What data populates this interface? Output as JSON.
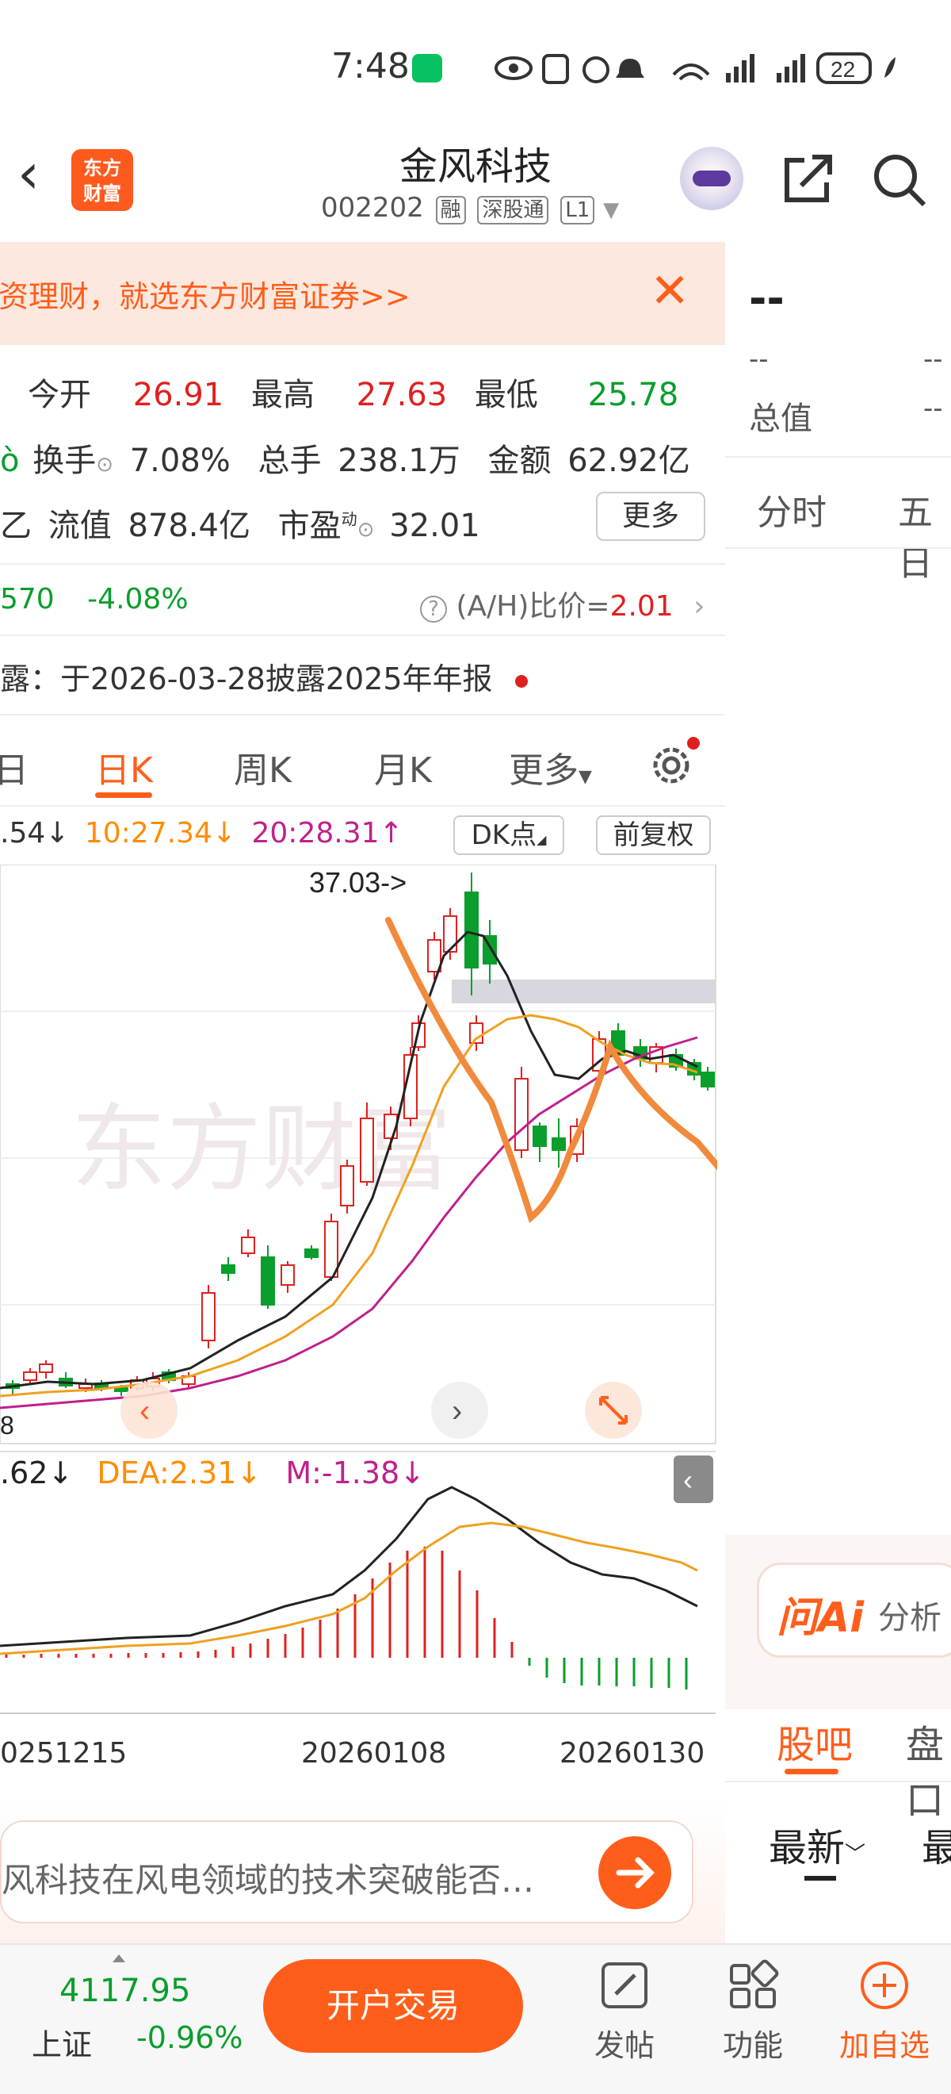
{
  "status": {
    "time": "7:48",
    "battery": "22"
  },
  "nav": {
    "title": "金风科技",
    "code": "002202",
    "tags": [
      "融",
      "深股通",
      "L1"
    ],
    "logo_line1": "东方",
    "logo_line2": "财富"
  },
  "banner": {
    "text": "投资理财，就选东方财富证券>>"
  },
  "quote": {
    "open_label": "今开",
    "open": "26.91",
    "high_label": "最高",
    "high": "27.63",
    "low_label": "最低",
    "low": "25.78",
    "turnover_label": "换手",
    "turnover": "7.08%",
    "volume_label": "总手",
    "volume": "238.1万",
    "amount_label": "金额",
    "amount": "62.92亿",
    "float_label": "流值",
    "float_cap": "878.4亿",
    "pe_label": "市盈",
    "pe_sup": "动",
    "pe": "32.01",
    "more": "更多"
  },
  "ah": {
    "price_part": "570",
    "pct": "-4.08%",
    "ratio_label": "(A/H)比价=",
    "ratio": "2.01"
  },
  "disclosure": {
    "label": "露：",
    "text": "于2026-03-28披露2025年年报"
  },
  "tabs": [
    {
      "label": "日"
    },
    {
      "label": "日K"
    },
    {
      "label": "周K"
    },
    {
      "label": "月K"
    },
    {
      "label": "更多"
    }
  ],
  "ma": {
    "ma5": ".54↓",
    "ma10": "10:27.34↓",
    "ma20": "20:28.31↑",
    "dk": "DK点",
    "adjust": "前复权"
  },
  "chart_data": {
    "type": "candlestick",
    "annotation": "37.03->",
    "left_price_label": "8",
    "macd_labels": {
      "dif": ".62↓",
      "dea": "DEA:2.31↓",
      "m": "M:-1.38↓"
    },
    "x_ticks": [
      "0251215",
      "20260108",
      "20260130"
    ],
    "watermark": "东方财富"
  },
  "right_panel": {
    "price": "--",
    "sub1": "--",
    "sub2": "--",
    "total_label": "总值",
    "total_val": "--",
    "tab_fenshi": "分时",
    "tab_wuri": "五日",
    "ai_label": "问Ai",
    "ai_text": "分析",
    "guba": "股吧",
    "pankou": "盘口",
    "newest": "最新",
    "newest2": "最"
  },
  "input": {
    "placeholder": "风科技在风电领域的技术突破能否…"
  },
  "bottom": {
    "index_value": "4117.95",
    "index_name": "上证",
    "index_pct": "-0.96%",
    "trade": "开户交易",
    "post": "发帖",
    "func": "功能",
    "add": "加自选"
  }
}
